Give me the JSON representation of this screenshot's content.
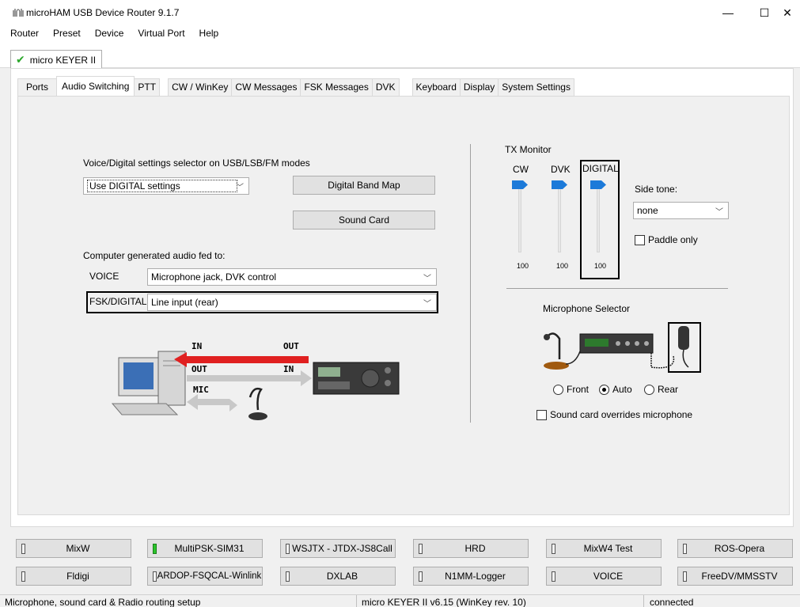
{
  "window": {
    "title": "microHAM USB Device Router 9.1.7",
    "min_glyph": "—",
    "max_glyph": "☐",
    "close_glyph": "✕"
  },
  "menu": [
    "Router",
    "Preset",
    "Device",
    "Virtual Port",
    "Help"
  ],
  "device_tab": {
    "label": "micro KEYER II",
    "status_icon": "check-icon"
  },
  "tabs": [
    "Ports",
    "Audio Switching",
    "PTT",
    "CW / WinKey",
    "CW Messages",
    "FSK Messages",
    "DVK",
    "Keyboard",
    "Display",
    "System Settings"
  ],
  "active_tab": "Audio Switching",
  "audio": {
    "selector_label": "Voice/Digital settings selector on USB/LSB/FM modes",
    "selector_value": "Use DIGITAL settings",
    "digital_band_map": "Digital Band Map",
    "sound_card": "Sound Card",
    "computer_audio_label": "Computer generated audio fed to:",
    "voice_label": "VOICE",
    "voice_value": "Microphone jack, DVK control",
    "fsk_label": "FSK/DIGITAL",
    "fsk_value": "Line input (rear)",
    "diagram": {
      "in_top": "IN",
      "out_top": "OUT",
      "out_mid": "OUT",
      "in_mid": "IN",
      "mic": "MIC"
    }
  },
  "tx_monitor": {
    "title": "TX Monitor",
    "sliders": [
      {
        "label": "CW",
        "value": "100"
      },
      {
        "label": "DVK",
        "value": "100"
      },
      {
        "label": "DIGITAL",
        "value": "100"
      }
    ],
    "side_tone_label": "Side tone:",
    "side_tone_value": "none",
    "paddle_only": "Paddle only"
  },
  "mic_selector": {
    "title": "Microphone Selector",
    "options": [
      "Front",
      "Auto",
      "Rear"
    ],
    "selected": "Auto",
    "override": "Sound card overrides microphone"
  },
  "router_buttons": [
    {
      "label": "MixW",
      "on": false
    },
    {
      "label": "MultiPSK-SIM31",
      "on": true
    },
    {
      "label": "WSJTX - JTDX-JS8Call",
      "on": false
    },
    {
      "label": "HRD",
      "on": false
    },
    {
      "label": "MixW4 Test",
      "on": false
    },
    {
      "label": "ROS-Opera",
      "on": false
    },
    {
      "label": "Fldigi",
      "on": false
    },
    {
      "label": "ARDOP-FSQCAL-Winlink",
      "on": false
    },
    {
      "label": "DXLAB",
      "on": false
    },
    {
      "label": "N1MM-Logger",
      "on": false
    },
    {
      "label": "VOICE",
      "on": false
    },
    {
      "label": "FreeDV/MMSSTV",
      "on": false
    }
  ],
  "status": {
    "left": "Microphone, sound card & Radio routing setup",
    "middle": "micro KEYER II v6.15 (WinKey rev. 10)",
    "right": "connected"
  },
  "colors": {
    "arrow_red": "#e02020",
    "arrow_gray": "#c8c8c8",
    "slider_thumb": "#1c7ad9",
    "led_on": "#2bc52b"
  }
}
